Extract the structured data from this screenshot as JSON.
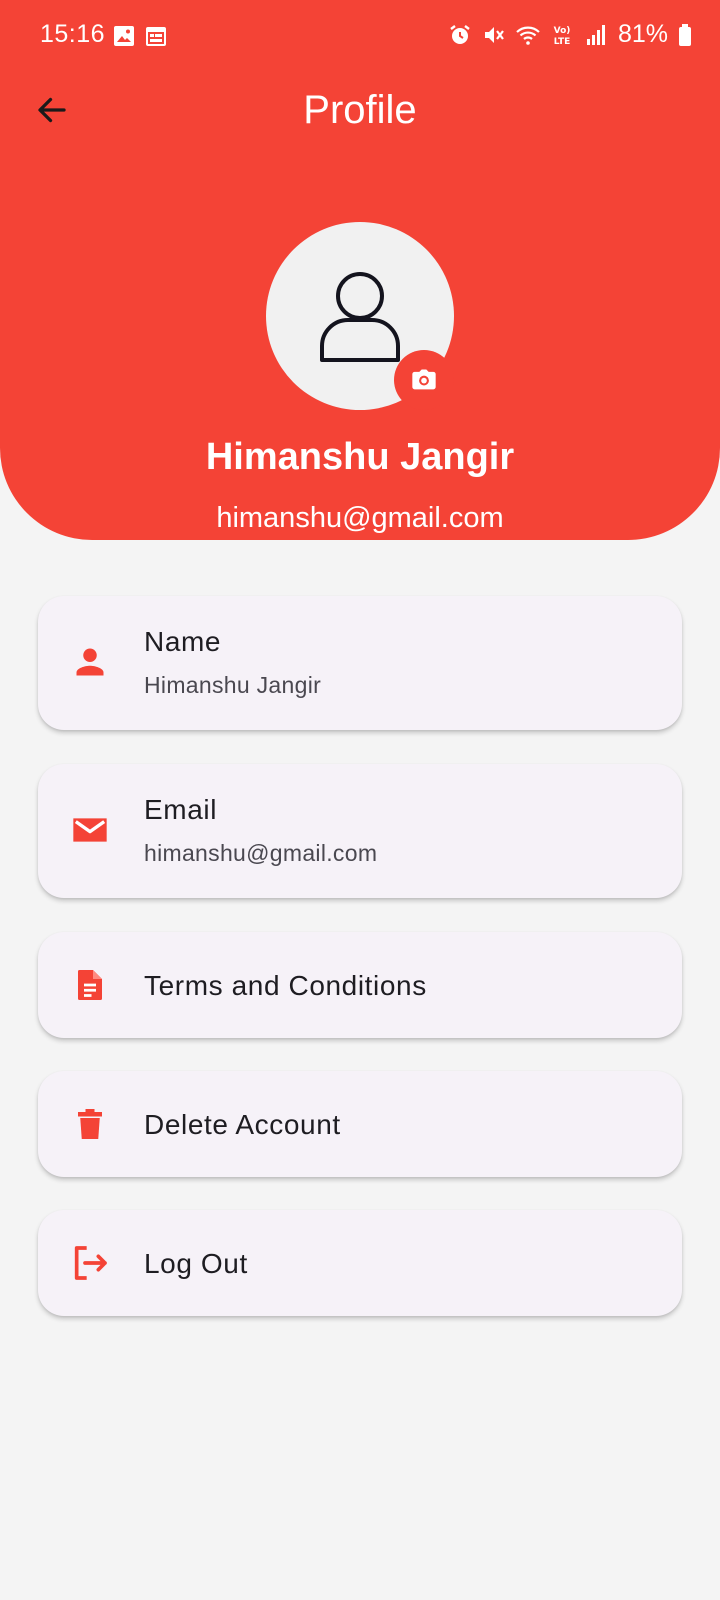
{
  "status_bar": {
    "time": "15:16",
    "battery_percent": "81%",
    "icons": [
      "gallery-icon",
      "calendar-icon",
      "alarm-icon",
      "mute-icon",
      "wifi-icon",
      "volte-icon",
      "signal-icon",
      "battery-icon"
    ]
  },
  "app_bar": {
    "title": "Profile",
    "back_icon": "back-arrow-icon"
  },
  "profile": {
    "name": "Himanshu Jangir",
    "email": "himanshu@gmail.com",
    "avatar_icon": "person-outline-icon",
    "camera_icon": "camera-icon"
  },
  "items": [
    {
      "id": "name",
      "icon": "person-icon",
      "label": "Name",
      "value": "Himanshu Jangir"
    },
    {
      "id": "email",
      "icon": "mail-icon",
      "label": "Email",
      "value": "himanshu@gmail.com"
    },
    {
      "id": "terms",
      "icon": "document-icon",
      "label": "Terms and Conditions"
    },
    {
      "id": "delete",
      "icon": "trash-icon",
      "label": "Delete Account"
    },
    {
      "id": "logout",
      "icon": "logout-icon",
      "label": "Log Out"
    }
  ],
  "colors": {
    "primary": "#f44336",
    "background": "#f4f4f4",
    "card": "#f6f2f8",
    "text": "#1e1d22"
  }
}
